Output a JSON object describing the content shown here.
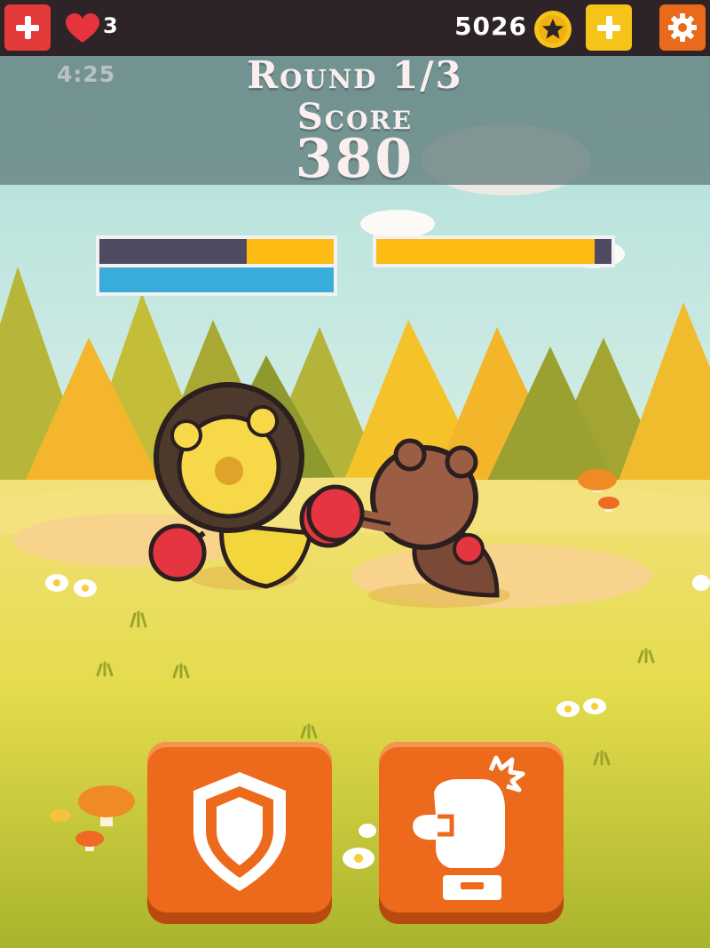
{
  "top_bar": {
    "lives_count": "3",
    "coin_balance": "5026"
  },
  "hud": {
    "timer": "4:25",
    "round_text": "Round 1/3",
    "score_label": "Score",
    "score_value": "380"
  },
  "health": {
    "player_health_fraction": 0.37,
    "player_energy_fraction": 1.0,
    "enemy_health_fraction": 0.93
  },
  "controls": {
    "block_icon": "shield-icon",
    "punch_icon": "boxing-glove-icon"
  },
  "colors": {
    "health_yellow": "#fdbc14",
    "energy_blue": "#3aacd9",
    "button_orange": "#ed6a1c",
    "top_bar_bg": "#2e2326"
  }
}
